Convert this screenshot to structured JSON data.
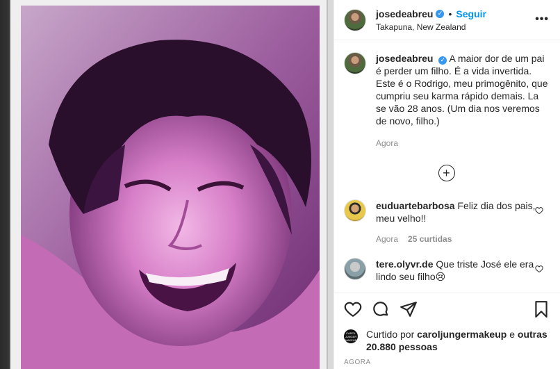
{
  "post": {
    "username": "josedeabreu",
    "verified_badge": "✓",
    "follow_label": "Seguir",
    "separator": "•",
    "location": "Takapuna, New Zealand",
    "more_label": "•••"
  },
  "caption": {
    "username": "josedeabreu",
    "text": "A maior dor de um pai é perder um filho. É a vida invertida. Este é o Rodrigo, meu primogênito, que cumpriu seu karma rápido demais. La se vão 28 anos. (Um dia nos veremos de novo, filho.)",
    "time": "Agora"
  },
  "load_more_icon": "plus-circle-icon",
  "comments": [
    {
      "username": "euduartebarbosa",
      "text": "Feliz dia dos pais, meu velho!!",
      "time": "Agora",
      "likes": "25 curtidas"
    },
    {
      "username": "tere.olyvr.de",
      "text": "Que triste José ele era lindo seu filho😢",
      "time": "",
      "likes": ""
    }
  ],
  "actions": {
    "icons": [
      "heart-icon",
      "comment-icon",
      "share-icon",
      "bookmark-icon"
    ]
  },
  "likes": {
    "prefix": "Curtido por",
    "user": "caroljungermakeup",
    "middle": "e",
    "others": "outras 20.880 pessoas",
    "avatar_text": "CAROL JUNGER MAKEUP"
  },
  "footer_time": "Agora",
  "colors": {
    "accent": "#0095f6",
    "verified": "#3897f0",
    "muted": "#8e8e8e"
  }
}
